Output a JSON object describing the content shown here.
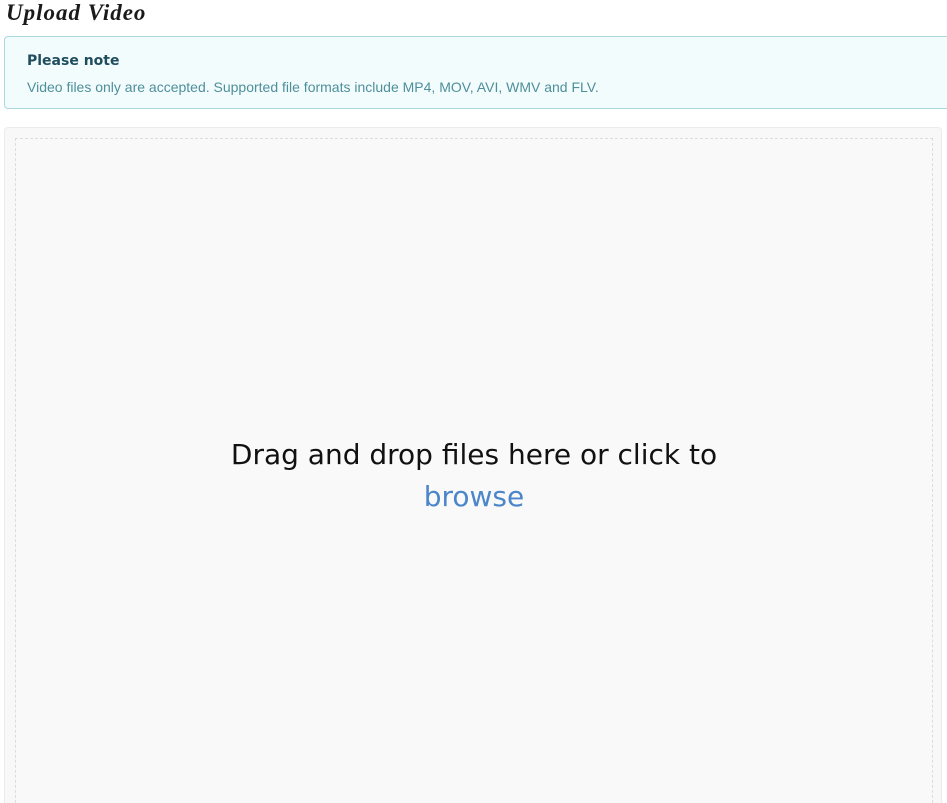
{
  "page": {
    "title": "Upload Video"
  },
  "note": {
    "title": "Please note",
    "text": "Video files only are accepted. Supported file formats include MP4, MOV, AVI, WMV and FLV."
  },
  "dropzone": {
    "prompt": "Drag and drop files here or click to",
    "browse_label": "browse"
  },
  "colors": {
    "note_background": "#f3fcfc",
    "note_border": "#a9d8de",
    "note_title": "#1f4d5e",
    "note_text": "#4e8f9c",
    "link": "#4a86c9"
  }
}
